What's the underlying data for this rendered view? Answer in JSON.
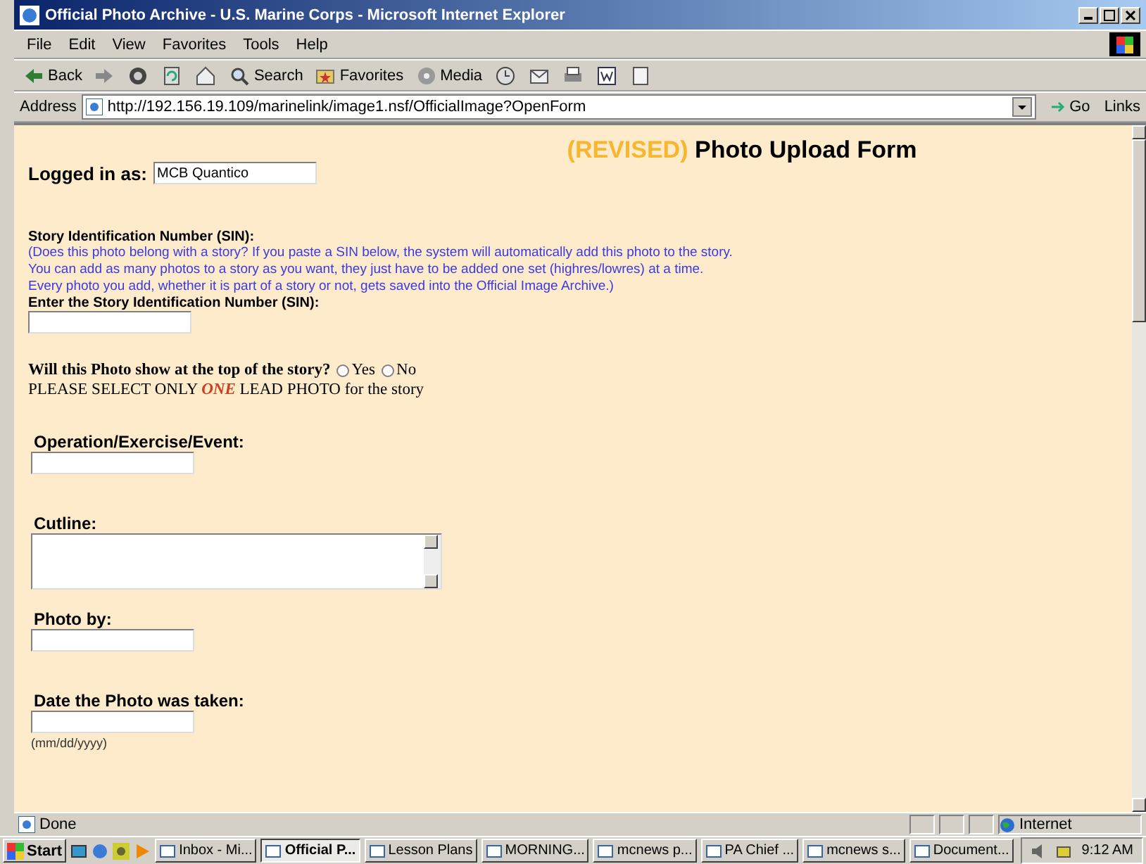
{
  "window": {
    "title": "Official Photo Archive - U.S. Marine Corps - Microsoft Internet Explorer"
  },
  "menu": [
    "File",
    "Edit",
    "View",
    "Favorites",
    "Tools",
    "Help"
  ],
  "toolbar": [
    {
      "kind": "back",
      "label": "Back"
    },
    {
      "kind": "forward"
    },
    {
      "kind": "stop"
    },
    {
      "kind": "refresh"
    },
    {
      "kind": "home"
    },
    {
      "kind": "search",
      "label": "Search"
    },
    {
      "kind": "favorites",
      "label": "Favorites"
    },
    {
      "kind": "media",
      "label": "Media"
    },
    {
      "kind": "history"
    },
    {
      "kind": "mail"
    },
    {
      "kind": "print"
    },
    {
      "kind": "edit"
    },
    {
      "kind": "discuss"
    }
  ],
  "address": {
    "label": "Address",
    "url": "http://192.156.19.109/marinelink/image1.nsf/OfficialImage?OpenForm",
    "go": "Go",
    "links": "Links"
  },
  "page": {
    "heading_prefix": "(REVISED)",
    "heading": "Photo Upload Form",
    "logged_in": {
      "label": "Logged in as:",
      "value": "MCB Quantico"
    },
    "sin": {
      "title": "Story Identification Number (SIN):",
      "note": [
        "(Does this photo belong with a story? If you paste a SIN below, the system will automatically add this photo to the story.",
        "You can add as many photos to a story as you want, they just have to be added one set (highres/lowres) at a time.",
        "Every photo you add, whether it is part of a story or not, gets saved into the Official Image Archive.)"
      ],
      "label": "Enter the Story Identification Number (SIN):"
    },
    "lead": {
      "question": "Will this Photo show at the top of the story?",
      "options": [
        {
          "label": "Yes",
          "selected": false
        },
        {
          "label": "No",
          "selected": false
        }
      ],
      "notice": "PLEASE SELECT ONLY *ONE* LEAD PHOTO for the story"
    },
    "fields": [
      {
        "label": "Operation/Exercise/Event:",
        "kind": "text"
      },
      {
        "label": "Cutline:",
        "kind": "textarea"
      },
      {
        "label": "Photo by:",
        "kind": "text"
      },
      {
        "label": "Date the Photo was taken:",
        "kind": "text",
        "hint": "(mm/dd/yyyy)"
      }
    ]
  },
  "status_bar": {
    "text": "Done",
    "zone": "Internet"
  },
  "taskbar": {
    "start": "Start",
    "tasks": [
      {
        "label": "Inbox - Mi...",
        "selected": false
      },
      {
        "label": "Official P...",
        "selected": true
      },
      {
        "label": "Lesson Plans",
        "selected": false
      },
      {
        "label": "MORNING...",
        "selected": false
      },
      {
        "label": "mcnews p...",
        "selected": false
      },
      {
        "label": "PA Chief ...",
        "selected": false
      },
      {
        "label": "mcnews s...",
        "selected": false
      },
      {
        "label": "Document...",
        "selected": false
      }
    ],
    "clock": "9:12 AM"
  }
}
